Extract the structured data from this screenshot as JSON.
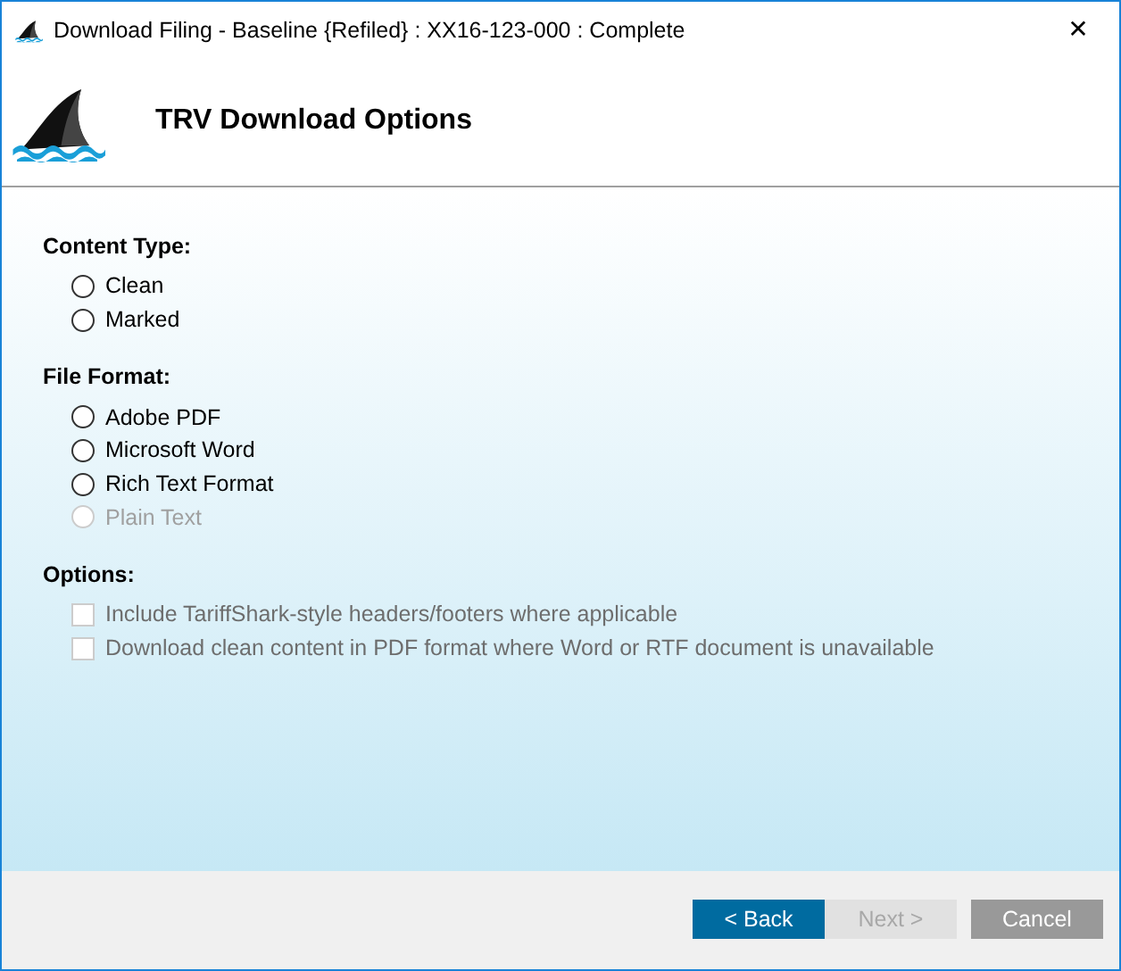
{
  "window": {
    "title": "Download Filing - Baseline {Refiled} : XX16-123-000 : Complete",
    "close": "✕"
  },
  "header": {
    "title": "TRV Download Options"
  },
  "sections": [
    {
      "kind": "radio",
      "heading": "Content Type:",
      "items": [
        {
          "label": "Clean",
          "selected": false,
          "disabled": false
        },
        {
          "label": "Marked",
          "selected": false,
          "disabled": false
        }
      ]
    },
    {
      "kind": "radio",
      "heading": "File Format:",
      "items": [
        {
          "label": "Adobe PDF",
          "selected": false,
          "disabled": false
        },
        {
          "label": "Microsoft Word",
          "selected": false,
          "disabled": false
        },
        {
          "label": "Rich Text Format",
          "selected": false,
          "disabled": false
        },
        {
          "label": "Plain Text",
          "selected": false,
          "disabled": true
        }
      ]
    },
    {
      "kind": "checkbox",
      "heading": "Options:",
      "items": [
        {
          "label": "Include TariffShark-style headers/footers where applicable",
          "checked": false,
          "disabled": true
        },
        {
          "label": "Download clean content in PDF format where Word or RTF document is unavailable",
          "checked": false,
          "disabled": true
        }
      ]
    }
  ],
  "buttons": [
    {
      "label": "< Back",
      "kind": "primary",
      "disabled": false
    },
    {
      "label": "Next >",
      "kind": "plain",
      "disabled": true
    },
    {
      "label": "Cancel",
      "kind": "cancel",
      "disabled": false
    }
  ]
}
